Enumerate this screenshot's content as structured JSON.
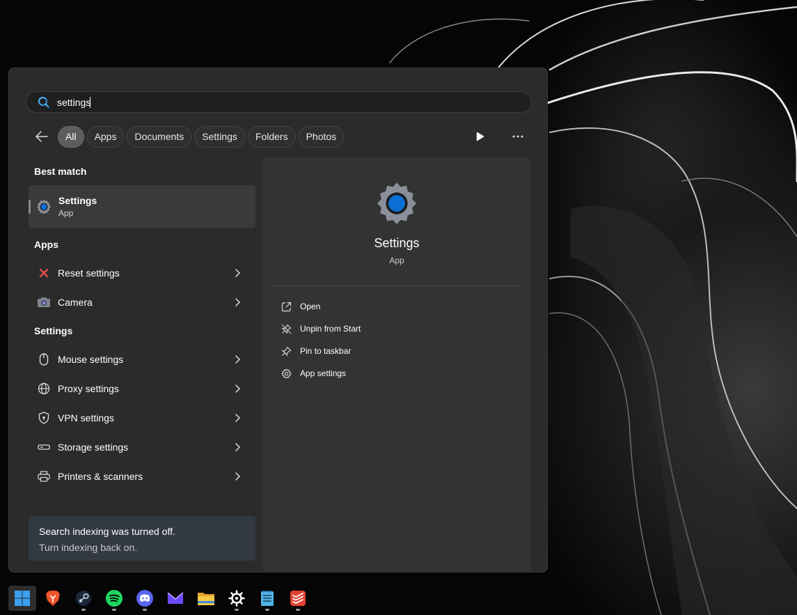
{
  "search": {
    "value": "settings",
    "placeholder": ""
  },
  "filters": {
    "chips": [
      "All",
      "Apps",
      "Documents",
      "Settings",
      "Folders",
      "Photos"
    ],
    "active": "All"
  },
  "left": {
    "best_match_title": "Best match",
    "best_match": {
      "name": "Settings",
      "type": "App"
    },
    "apps_title": "Apps",
    "apps": [
      {
        "label": "Reset settings",
        "icon": "red-x-icon"
      },
      {
        "label": "Camera",
        "icon": "camera-icon"
      }
    ],
    "settings_title": "Settings",
    "settings": [
      {
        "label": "Mouse settings",
        "icon": "mouse-icon"
      },
      {
        "label": "Proxy settings",
        "icon": "globe-icon"
      },
      {
        "label": "VPN settings",
        "icon": "shield-icon"
      },
      {
        "label": "Storage settings",
        "icon": "storage-icon"
      },
      {
        "label": "Printers & scanners",
        "icon": "printer-icon"
      }
    ],
    "index_note": {
      "line1": "Search indexing was turned off.",
      "line2": "Turn indexing back on."
    }
  },
  "detail": {
    "name": "Settings",
    "type": "App",
    "actions": [
      {
        "label": "Open",
        "icon": "open-external-icon"
      },
      {
        "label": "Unpin from Start",
        "icon": "unpin-icon"
      },
      {
        "label": "Pin to taskbar",
        "icon": "pin-icon"
      },
      {
        "label": "App settings",
        "icon": "gear-icon"
      }
    ]
  },
  "colors": {
    "accent_blue": "#0a6fd4",
    "panel_bg": "#2b2b2b",
    "detail_bg": "#333333",
    "red_x": "#e05252"
  },
  "taskbar": {
    "apps": [
      "windows-start-icon",
      "brave-icon",
      "steam-icon",
      "spotify-icon",
      "discord-icon",
      "proton-mail-icon",
      "file-explorer-icon",
      "steelseries-icon",
      "notepad-icon",
      "todoist-icon"
    ]
  }
}
